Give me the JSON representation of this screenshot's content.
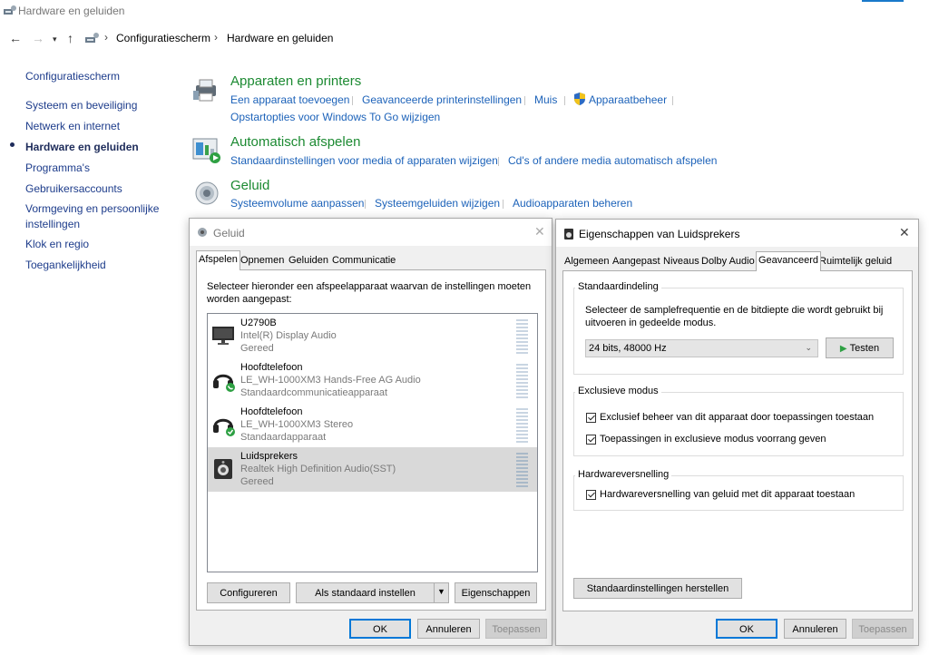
{
  "window": {
    "title": "Hardware en geluiden"
  },
  "address": {
    "crumbs": [
      "Configuratiescherm",
      "Hardware en geluiden"
    ]
  },
  "sidebar": {
    "items": [
      "Configuratiescherm",
      "Systeem en beveiliging",
      "Netwerk en internet",
      "Hardware en geluiden",
      "Programma's",
      "Gebruikersaccounts",
      "Vormgeving en persoonlijke",
      "instellingen",
      "Klok en regio",
      "Toegankelijkheid"
    ],
    "active_index": 3
  },
  "categories": [
    {
      "title": "Apparaten en printers",
      "icon": "printer-icon",
      "links": [
        "Een apparaat toevoegen",
        "Geavanceerde printerinstellingen",
        "Muis",
        "Apparaatbeheer",
        "Opstartopties voor Windows To Go wijzigen"
      ]
    },
    {
      "title": "Automatisch afspelen",
      "icon": "autoplay-icon",
      "links": [
        "Standaardinstellingen voor media of apparaten wijzigen",
        "Cd's of andere media automatisch afspelen"
      ]
    },
    {
      "title": "Geluid",
      "icon": "speaker-icon",
      "links": [
        "Systeemvolume aanpassen",
        "Systeemgeluiden wijzigen",
        "Audioapparaten beheren"
      ]
    }
  ],
  "sound_dialog": {
    "title": "Geluid",
    "tabs": [
      "Afspelen",
      "Opnemen",
      "Geluiden",
      "Communicatie"
    ],
    "active_tab": 0,
    "instruction": [
      "Selecteer hieronder een afspeelapparaat waarvan de instellingen moeten",
      "worden aangepast:"
    ],
    "devices": [
      {
        "name": "U2790B",
        "desc": "Intel(R) Display Audio",
        "status": "Gereed",
        "icon": "monitor-icon"
      },
      {
        "name": "Hoofdtelefoon",
        "desc": "LE_WH-1000XM3 Hands-Free AG Audio",
        "status": "Standaardcommunicatieapparaat",
        "icon": "headphones-phone-icon"
      },
      {
        "name": "Hoofdtelefoon",
        "desc": "LE_WH-1000XM3 Stereo",
        "status": "Standaardapparaat",
        "icon": "headphones-check-icon"
      },
      {
        "name": "Luidsprekers",
        "desc": "Realtek High Definition Audio(SST)",
        "status": "Gereed",
        "icon": "speaker-device-icon"
      }
    ],
    "selected_device": 3,
    "buttons": {
      "configure": "Configureren",
      "set_default": "Als standaard instellen",
      "properties": "Eigenschappen",
      "ok": "OK",
      "cancel": "Annuleren",
      "apply": "Toepassen"
    }
  },
  "props_dialog": {
    "title": "Eigenschappen van Luidsprekers",
    "tabs": [
      "Algemeen",
      "Aangepast",
      "Niveaus",
      "Dolby Audio",
      "Geavanceerd",
      "Ruimtelijk geluid"
    ],
    "active_tab": 4,
    "default_format": {
      "label": "Standaardindeling",
      "text": [
        "Selecteer de samplefrequentie en de bitdiepte die wordt gebruikt bij",
        "uitvoeren in gedeelde modus."
      ],
      "selected": "24 bits, 48000 Hz",
      "test_button": "Testen"
    },
    "exclusive": {
      "label": "Exclusieve modus",
      "options": [
        {
          "label": "Exclusief beheer van dit apparaat door toepassingen toestaan",
          "checked": true
        },
        {
          "label": "Toepassingen in exclusieve modus voorrang geven",
          "checked": true
        }
      ]
    },
    "hw_accel": {
      "label": "Hardwareversnelling",
      "options": [
        {
          "label": "Hardwareversnelling van geluid met dit apparaat toestaan",
          "checked": true
        }
      ]
    },
    "restore_button": "Standaardinstellingen herstellen",
    "buttons": {
      "ok": "OK",
      "cancel": "Annuleren",
      "apply": "Toepassen"
    }
  },
  "colors": {
    "link": "#1c62b9",
    "category_title": "#1c8a32",
    "accent": "#0078d7"
  }
}
